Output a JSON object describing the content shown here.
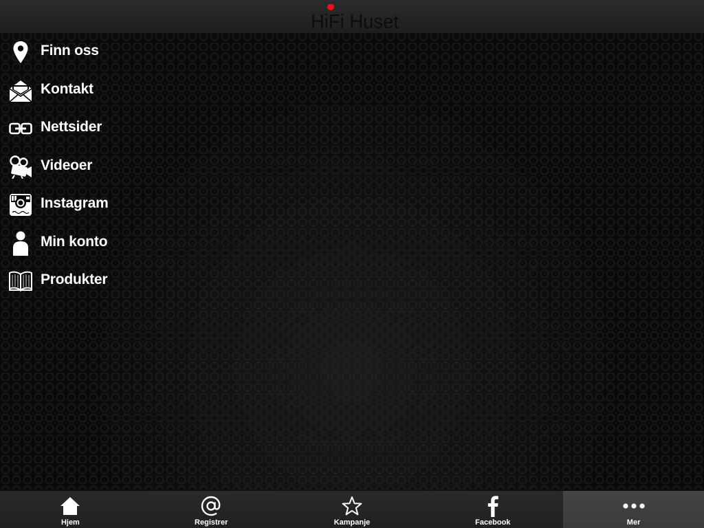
{
  "header": {
    "logo_text": "HiFi Huset",
    "logo_colors": {
      "text": "#0d0d0d",
      "dot": "#e8101b"
    }
  },
  "menu": {
    "items": [
      {
        "label": "Finn oss",
        "icon": "location-pin-icon"
      },
      {
        "label": "Kontakt",
        "icon": "envelope-icon"
      },
      {
        "label": "Nettsider",
        "icon": "link-icon"
      },
      {
        "label": "Videoer",
        "icon": "video-camera-icon"
      },
      {
        "label": "Instagram",
        "icon": "instagram-icon"
      },
      {
        "label": "Min konto",
        "icon": "user-icon"
      },
      {
        "label": "Produkter",
        "icon": "book-icon"
      }
    ]
  },
  "tabbar": {
    "tabs": [
      {
        "label": "Hjem",
        "icon": "home-icon"
      },
      {
        "label": "Registrer",
        "icon": "at-sign-icon"
      },
      {
        "label": "Kampanje",
        "icon": "star-icon"
      },
      {
        "label": "Facebook",
        "icon": "facebook-icon"
      },
      {
        "label": "Mer",
        "icon": "more-dots-icon"
      }
    ],
    "active": "Mer"
  },
  "colors": {
    "header_bg": "#262626",
    "tabbar_bg": "#252525",
    "active_tab_bg": "#404040",
    "text": "#ffffff"
  }
}
